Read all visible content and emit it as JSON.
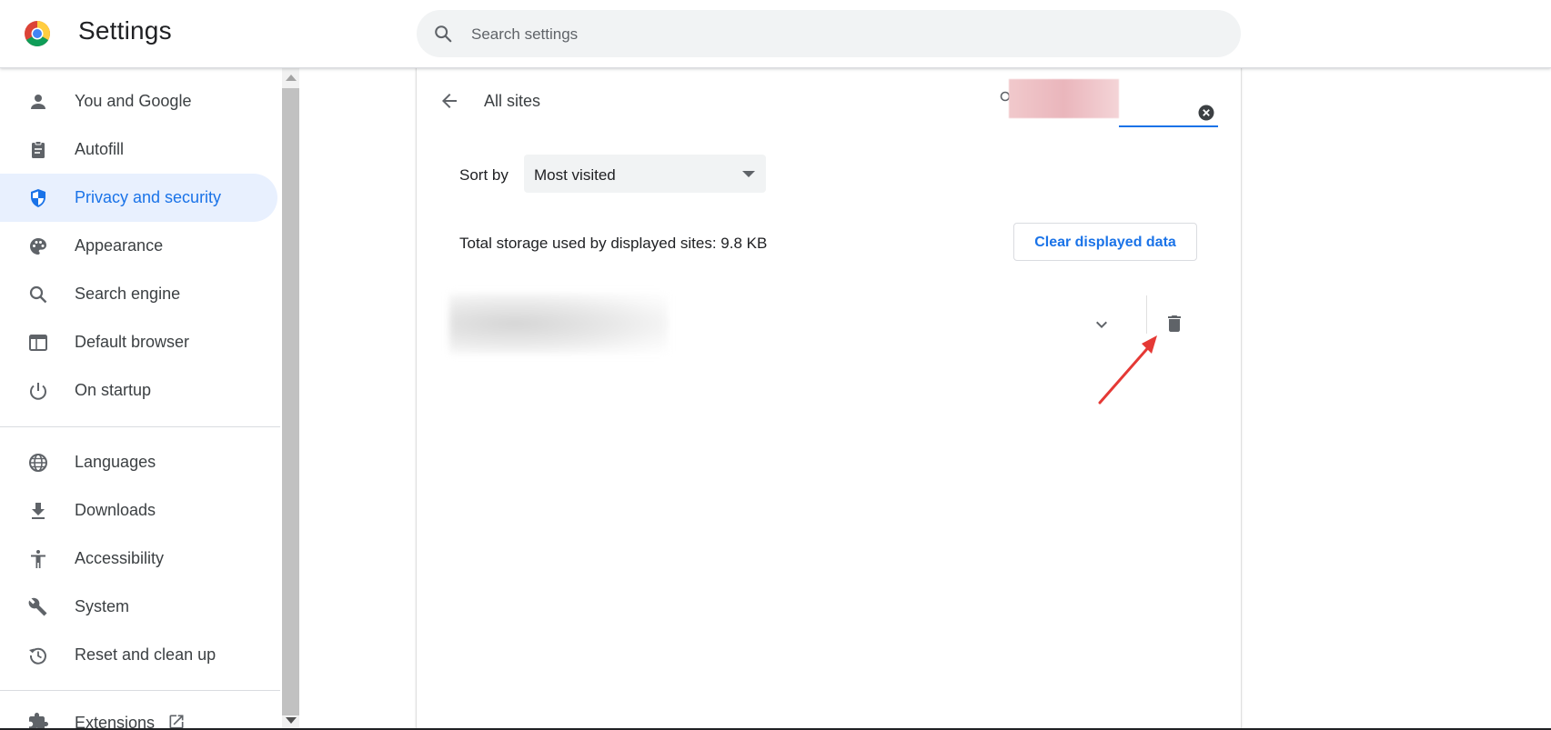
{
  "header": {
    "title": "Settings",
    "search_placeholder": "Search settings"
  },
  "sidebar": {
    "items": [
      {
        "label": "You and Google",
        "icon": "person-icon"
      },
      {
        "label": "Autofill",
        "icon": "clipboard-icon"
      },
      {
        "label": "Privacy and security",
        "icon": "shield-icon",
        "active": true
      },
      {
        "label": "Appearance",
        "icon": "palette-icon"
      },
      {
        "label": "Search engine",
        "icon": "search-icon"
      },
      {
        "label": "Default browser",
        "icon": "browser-icon"
      },
      {
        "label": "On startup",
        "icon": "power-icon"
      },
      {
        "label": "Languages",
        "icon": "globe-icon"
      },
      {
        "label": "Downloads",
        "icon": "download-icon"
      },
      {
        "label": "Accessibility",
        "icon": "accessibility-icon"
      },
      {
        "label": "System",
        "icon": "wrench-icon"
      },
      {
        "label": "Reset and clean up",
        "icon": "history-icon"
      },
      {
        "label": "Extensions",
        "icon": "puzzle-icon"
      }
    ]
  },
  "main": {
    "title": "All sites",
    "sort_label": "Sort by",
    "sort_value": "Most visited",
    "storage_text": "Total storage used by displayed sites: 9.8 KB",
    "clear_button": "Clear displayed data"
  },
  "colors": {
    "accent": "#1a73e8",
    "active_bg": "#e8f0fe",
    "annotation": "#e53935"
  }
}
